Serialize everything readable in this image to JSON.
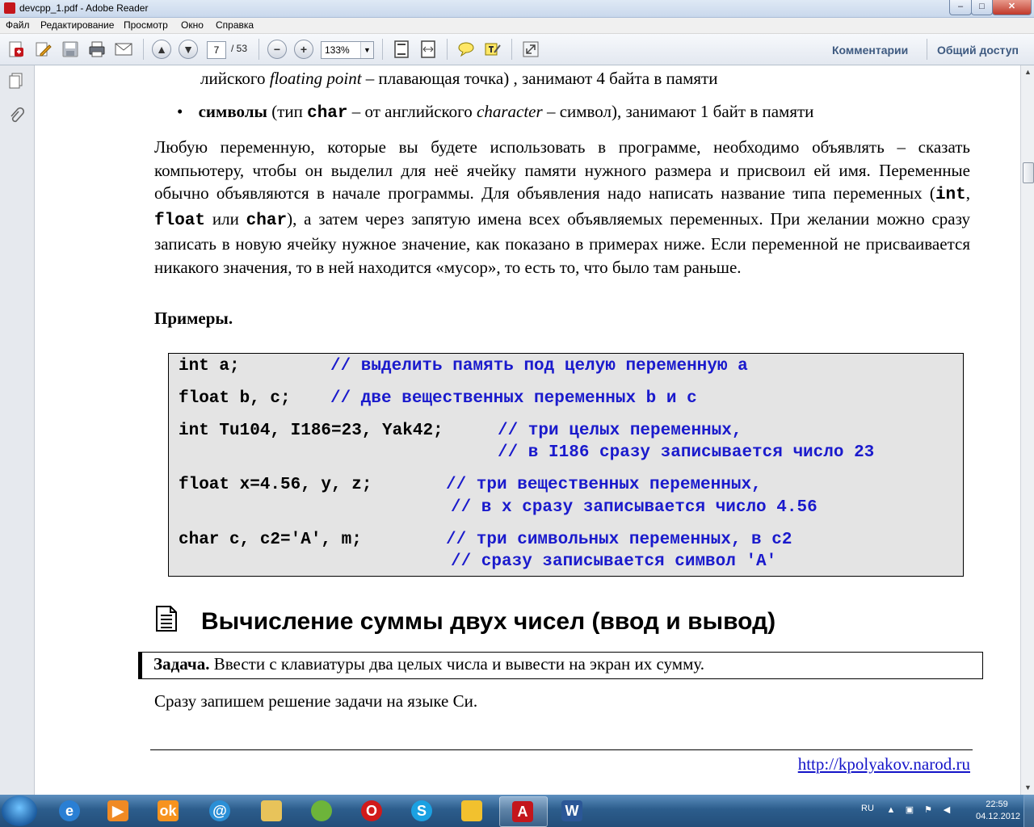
{
  "window": {
    "title": "devcpp_1.pdf - Adobe Reader",
    "minimize": "–",
    "maximize": "□",
    "close": "✕"
  },
  "menu": [
    "Файл",
    "Редактирование",
    "Просмотр",
    "Окно",
    "Справка"
  ],
  "toolbar": {
    "page_current": "7",
    "page_total": "/ 53",
    "zoom": "133%",
    "zoom_out": "−",
    "zoom_in": "+",
    "prev_page": "▲",
    "next_page": "▼",
    "comments": "Комментарии",
    "share": "Общий доступ"
  },
  "document": {
    "line_top_prefix": "лийского ",
    "line_top_italic": "floating point",
    "line_top_suffix": " – плавающая точка) , занимают 4 байта в памяти",
    "bullet_char": "•",
    "bullet_bold": "символы",
    "bullet_t1": " (тип ",
    "bullet_code": "char",
    "bullet_t2": " – от английского ",
    "bullet_italic": "character",
    "bullet_t3": " – символ), занимают 1 байт в памяти",
    "para_a": "Любую переменную, которые вы будете использовать в программе, необходимо объявлять – сказать компьютеру, чтобы он выделил для неё ячейку памяти нужного размера и присвоил ей имя. Переменные обычно объявляются в начале программы. Для объявления надо написать название типа переменных (",
    "para_code1": "int",
    "para_sep1": ", ",
    "para_code2": "float",
    "para_sep2": " или ",
    "para_code3": "char",
    "para_b": "), а затем через запятую имена всех объявляемых переменных. При желании можно сразу записать в новую ячейку нужное значение, как показано в примерах ниже. Если переменной не присваивается никакого значения, то в ней находится «мусор», то есть то, что было там раньше.",
    "examples_heading": "Примеры.",
    "code": [
      {
        "code": "int a;",
        "comment": "// выделить память под целую переменную a"
      },
      {
        "code": "float b, c;",
        "comment": "// две вещественных переменных b и c"
      },
      {
        "code": "int Tu104, I186=23, Yak42;",
        "comment": "// три целых переменных,"
      },
      {
        "code": "",
        "comment": "// в I186 сразу записывается число 23"
      },
      {
        "code": "float x=4.56, y, z;",
        "comment": "// три вещественных переменных,"
      },
      {
        "code": "",
        "comment": "// в x сразу записывается число 4.56"
      },
      {
        "code": "char c, c2='A', m;",
        "comment": "// три символьных переменных, в c2"
      },
      {
        "code": "",
        "comment": "// сразу записывается символ 'A'"
      }
    ],
    "section_title": "Вычисление суммы двух чисел (ввод и вывод)",
    "task_label": "Задача.",
    "task_text": " Ввести с клавиатуры два целых числа и вывести на экран их сумму.",
    "solution_text": "Сразу запишем решение задачи на языке Си.",
    "footer_link": "http://kpolyakov.narod.ru"
  },
  "taskbar": {
    "lang": "RU",
    "time": "22:59",
    "date": "04.12.2012",
    "apps": [
      "internet-explorer",
      "media-player",
      "odnoklassniki",
      "network",
      "file-explorer",
      "pinball",
      "opera",
      "skype",
      "security-center",
      "adobe-reader",
      "word"
    ]
  },
  "colors": {
    "code_comment": "#1a1acc",
    "code_bg": "#e4e4e4",
    "link": "#1414c8",
    "adobe_red": "#c4161c"
  }
}
